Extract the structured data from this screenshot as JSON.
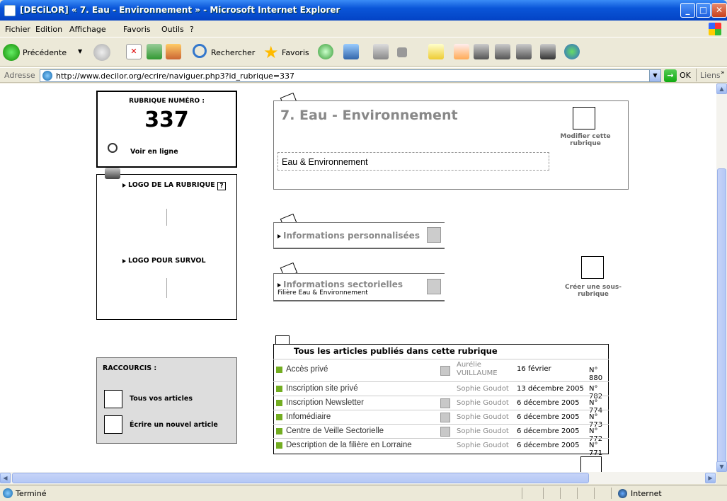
{
  "window": {
    "title": "[DECiLOR] « 7. Eau - Environnement » - Microsoft Internet Explorer"
  },
  "menu": [
    "Fichier",
    "Edition",
    "Affichage",
    "Favoris",
    "Outils",
    "?"
  ],
  "toolbar": {
    "back": "Précédente",
    "search": "Rechercher",
    "favorites": "Favoris"
  },
  "address": {
    "label": "Adresse",
    "url": "http://www.decilor.org/ecrire/naviguer.php3?id_rubrique=337",
    "go": "OK",
    "links": "Liens"
  },
  "rubrique": {
    "label": "RUBRIQUE NUMÉRO :",
    "number": "337",
    "voir": "Voir en ligne"
  },
  "logo": {
    "label": "LOGO DE LA RUBRIQUE",
    "help": "?",
    "survol": "LOGO POUR SURVOL"
  },
  "raccourcis": {
    "title": "RACCOURCIS :",
    "tous": "Tous vos articles",
    "ecrire": "Écrire un nouvel article"
  },
  "header": {
    "title": "7. Eau - Environnement",
    "desc": "Eau & Environnement",
    "modifier": "Modifier cette rubrique"
  },
  "info_perso": "Informations personnalisées",
  "info_sect": {
    "title": "Informations sectorielles",
    "sub": "Filière Eau & Environnement"
  },
  "creer": "Créer une sous-rubrique",
  "articles": {
    "title": "Tous les articles publiés dans cette rubrique",
    "rows": [
      {
        "title": "Accès privé",
        "author": "Aurélie VUILLAUME",
        "date": "16 février",
        "num": "N° 880"
      },
      {
        "title": "Inscription site privé",
        "author": "Sophie Goudot",
        "date": "13 décembre 2005",
        "num": "N° 782"
      },
      {
        "title": "Inscription Newsletter",
        "author": "Sophie Goudot",
        "date": "6 décembre 2005",
        "num": "N° 774"
      },
      {
        "title": "Infomédiaire",
        "author": "Sophie Goudot",
        "date": "6 décembre 2005",
        "num": "N° 773"
      },
      {
        "title": "Centre de Veille Sectorielle",
        "author": "Sophie Goudot",
        "date": "6 décembre 2005",
        "num": "N° 772"
      },
      {
        "title": "Description de la filière en Lorraine",
        "author": "Sophie Goudot",
        "date": "6 décembre 2005",
        "num": "N° 771"
      }
    ]
  },
  "status": {
    "left": "Terminé",
    "zone": "Internet"
  },
  "colors": {
    "bullet": "#73ad21",
    "titlebar": "#0a55d8"
  }
}
